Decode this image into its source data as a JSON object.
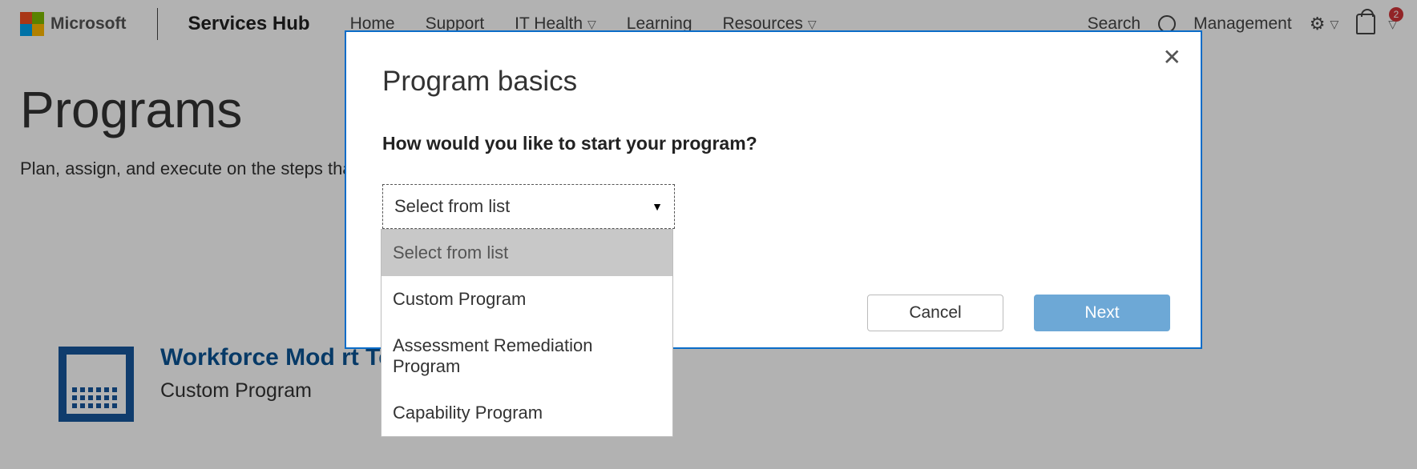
{
  "header": {
    "logo_text": "Microsoft",
    "brand": "Services Hub",
    "nav": {
      "home": "Home",
      "support": "Support",
      "ithealth": "IT Health",
      "learning": "Learning",
      "resources": "Resources"
    },
    "search_label": "Search",
    "management_label": "Management",
    "badge_count": "2"
  },
  "page": {
    "title": "Programs",
    "subtitle": "Plan, assign, and execute on the steps that y",
    "card": {
      "title_visible": "Workforce Mod                                      rt Teams",
      "subtitle": "Custom Program"
    }
  },
  "modal": {
    "title": "Program basics",
    "question": "How would you like to start your program?",
    "select_placeholder": "Select from list",
    "cancel": "Cancel",
    "next": "Next"
  },
  "dropdown": {
    "options": {
      "placeholder": "Select from list",
      "opt1": "Custom Program",
      "opt2": "Assessment Remediation Program",
      "opt3": "Capability Program"
    }
  }
}
